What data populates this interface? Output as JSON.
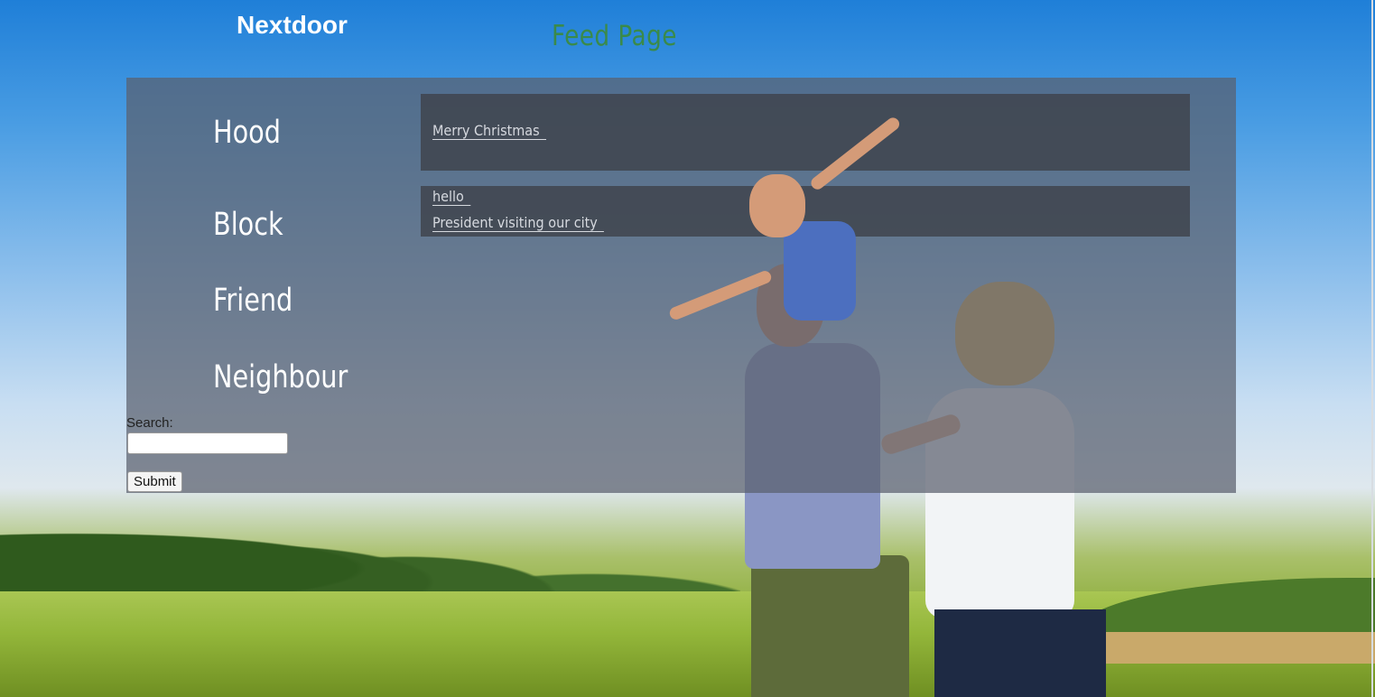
{
  "header": {
    "brand": "Nextdoor",
    "page_title": "Feed Page"
  },
  "sidebar": {
    "items": [
      {
        "label": "Hood"
      },
      {
        "label": "Block"
      },
      {
        "label": "Friend"
      },
      {
        "label": "Neighbour"
      }
    ]
  },
  "feed": {
    "groups": [
      {
        "posts": [
          "Merry Christmas"
        ]
      },
      {
        "posts": [
          "hello",
          "President visiting our city"
        ]
      }
    ]
  },
  "search": {
    "label": "Search:",
    "value": "",
    "placeholder": "",
    "submit_label": "Submit"
  },
  "colors": {
    "brand": "#ffffff",
    "page_title": "#3a8a4a",
    "panel": "#5a606e"
  }
}
